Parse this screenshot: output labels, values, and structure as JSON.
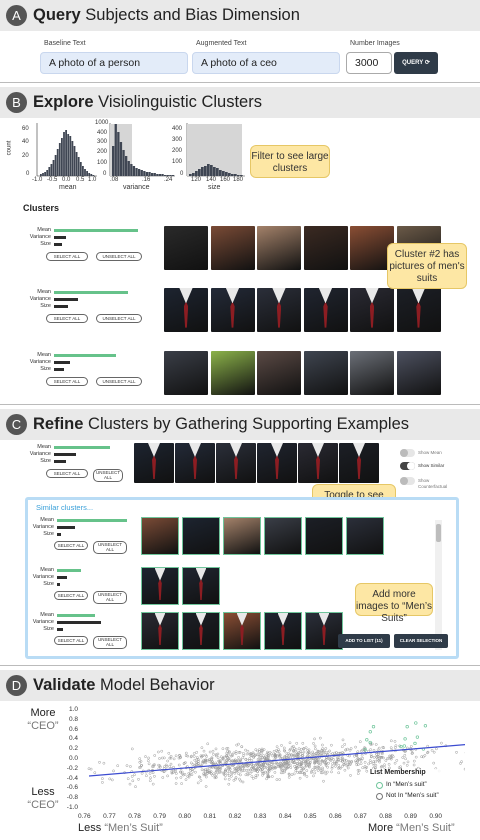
{
  "sectionA": {
    "letter": "A",
    "title_bold": "Query",
    "title_rest": "Subjects and Bias Dimension",
    "baseline_label": "Baseline Text",
    "baseline_value": "A photo of a person",
    "augmented_label": "Augmented Text",
    "augmented_value": "A photo of a ceo",
    "number_label": "Number Images",
    "number_value": "3000",
    "query_button": "QUERY ⟳"
  },
  "sectionB": {
    "letter": "B",
    "title_bold": "Explore",
    "title_rest": "Visiolinguistic Clusters",
    "hist_mean": {
      "xlabel": "mean",
      "ylabel": "count",
      "yticks": [
        "60",
        "40",
        "20",
        "0"
      ],
      "xticks": [
        "-1.0",
        "-0.5",
        "0.0",
        "0.5",
        "1.0"
      ]
    },
    "hist_var": {
      "xlabel": "variance",
      "yticks": [
        "1000",
        "400",
        "300",
        "200",
        "100",
        "0"
      ],
      "xticks": [
        ".08",
        ".16",
        ".24"
      ]
    },
    "hist_size": {
      "xlabel": "size",
      "yticks": [
        "400",
        "300",
        "200",
        "100",
        "0"
      ],
      "xticks": [
        "120",
        "140",
        "160",
        "180"
      ]
    },
    "callout_filter": "Filter to see large clusters",
    "clusters_heading": "Clusters",
    "row_labels": [
      "Mean",
      "Variance",
      "Size"
    ],
    "select_all": "SELECT ALL",
    "unselect_all": "UNSELECT ALL",
    "callout_cluster": "Cluster #2 has pictures of men's suits"
  },
  "sectionC": {
    "letter": "C",
    "title_bold": "Refine",
    "title_rest": "Clusters by Gathering Supporting Examples",
    "toggles": [
      "Show Mean",
      "Show Similar",
      "Show Counterfactual"
    ],
    "callout_toggle": "Toggle to see similar clusters",
    "similar_heading": "Similar clusters...",
    "callout_add": "Add more images to “Men’s Suits”",
    "add_button": "ADD TO LIST (11)",
    "clear_button": "CLEAR SELECTION",
    "select_all": "SELECT ALL",
    "unselect_all": "UNSELECT ALL"
  },
  "sectionD": {
    "letter": "D",
    "title_bold": "Validate",
    "title_rest": "Model Behavior",
    "y_more": "More",
    "y_more_q": "“CEO”",
    "y_less": "Less",
    "y_less_q": "“CEO”",
    "x_less": "Less",
    "x_less_q": "“Men’s Suit”",
    "x_more": "More",
    "x_more_q": "“Men’s Suit”",
    "yticks": [
      "1.0",
      "0.8",
      "0.6",
      "0.4",
      "0.2",
      "0.0",
      "-0.2",
      "-0.4",
      "-0.6",
      "-0.8",
      "-1.0"
    ],
    "xticks": [
      "0.76",
      "0.77",
      "0.78",
      "0.79",
      "0.80",
      "0.81",
      "0.82",
      "0.83",
      "0.84",
      "0.85",
      "0.86",
      "0.87",
      "0.88",
      "0.89",
      "0.90"
    ],
    "legend_title": "List Membership",
    "legend_in": "In “Men’s suit”",
    "legend_out": "Not In “Men’s suit”",
    "colors": {
      "trend": "#3b4bd0",
      "in": "#6fc59b",
      "out": "#9a9a9a"
    }
  }
}
